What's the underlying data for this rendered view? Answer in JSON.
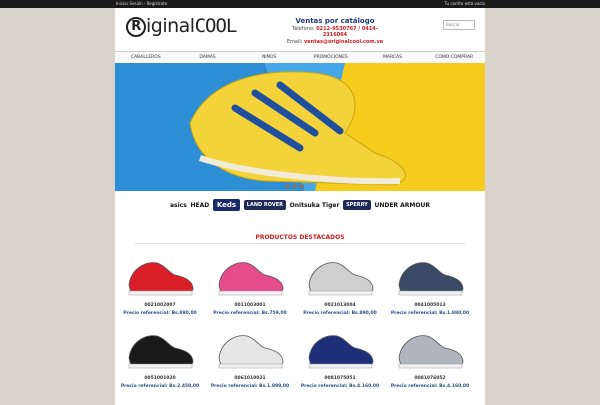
{
  "topbar": {
    "left": "Iniciar Sesión - Regístrate",
    "right": "Tu carrito está vacío"
  },
  "logo": {
    "text_r": "R",
    "text_iginal": "iginal",
    "text_cool": "COOL"
  },
  "contact": {
    "title": "Ventas por catálogo",
    "phone_label": "Telefono:",
    "phone": "0212-9530767 / 0414-2316064",
    "email_label": "Email:",
    "email": "ventas@originalcool.com.ve"
  },
  "search": {
    "placeholder": "Buscar"
  },
  "nav": [
    "CABALLEROS",
    "DAMAS",
    "NIÑOS",
    "PROMOCIONES",
    "MARCAS",
    "COMO COMPRAR"
  ],
  "banner": {
    "dots": "● ● ●"
  },
  "brands": [
    "asics",
    "HEAD",
    "Keds",
    "LAND ROVER",
    "Onitsuka Tiger",
    "SPERRY",
    "UNDER ARMOUR"
  ],
  "section_title": "PRODUCTOS DESTACADOS",
  "products": [
    {
      "code": "0021002007",
      "price": "Precio referencial: Bs.890,00",
      "color": "#d91e28"
    },
    {
      "code": "0011003001",
      "price": "Precio referencial: Bs.759,00",
      "color": "#e64b8b"
    },
    {
      "code": "0021013004",
      "price": "Precio referencial: Bs.890,00",
      "color": "#cfcfcf"
    },
    {
      "code": "0041005013",
      "price": "Precio referencial: Bs.1.880,00",
      "color": "#3a4a66"
    },
    {
      "code": "0051001020",
      "price": "Precio referencial: Bs.2.450,00",
      "color": "#1a1a1a"
    },
    {
      "code": "0061010021",
      "price": "Precio referencial: Bs.1.899,00",
      "color": "#e6e6e6"
    },
    {
      "code": "0081075051",
      "price": "Precio referencial: Bs.4.160,00",
      "color": "#1e2f7a"
    },
    {
      "code": "0081076052",
      "price": "Precio referencial: Bs.4.160,00",
      "color": "#b0b5bd"
    }
  ]
}
